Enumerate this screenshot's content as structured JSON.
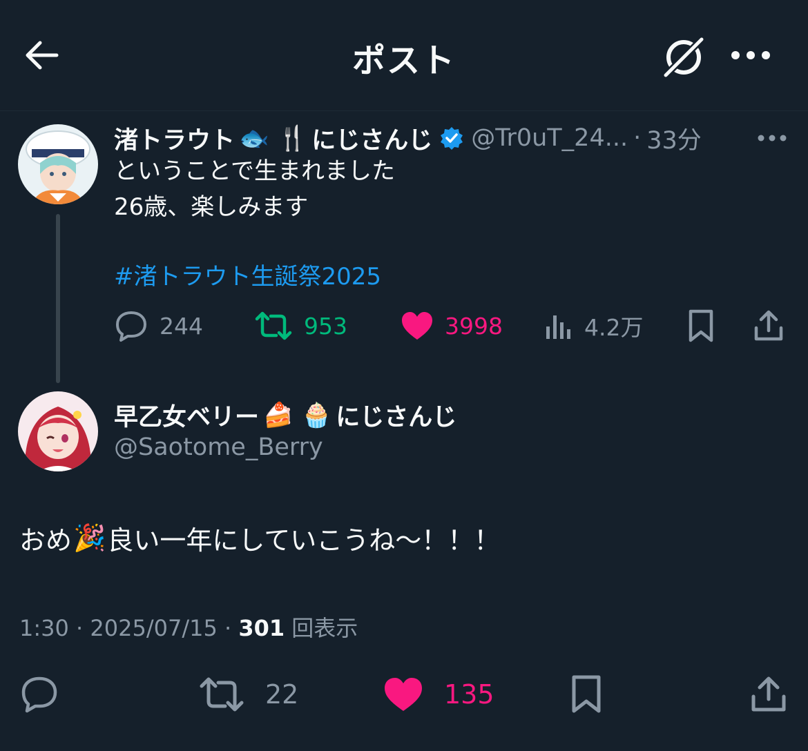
{
  "header": {
    "title": "ポスト"
  },
  "post": {
    "display_name": "渚トラウト",
    "name_emojis": [
      "🐟",
      "🍴"
    ],
    "affiliation": "にじさんじ",
    "handle": "@Tr0uT_24...",
    "separator": "·",
    "time": "33分",
    "lines": [
      "ということで生まれました",
      "26歳、楽しみます"
    ],
    "hashtag": "#渚トラウト生誕祭2025",
    "replies": "244",
    "reposts": "953",
    "likes": "3998",
    "views": "4.2万"
  },
  "reply": {
    "display_name": "早乙女ベリー",
    "name_emojis": [
      "🍰",
      "🧁"
    ],
    "affiliation": "にじさんじ",
    "handle": "@Saotome_Berry",
    "text_before": "おめ",
    "text_emoji": "🎉",
    "text_after": "良い一年にしていこうね〜！！！",
    "time": "1:30",
    "date": "2025/07/15",
    "separator": "·",
    "view_count": "301",
    "view_label": "回表示",
    "reposts": "22",
    "likes": "135"
  },
  "colors": {
    "background": "#15202b",
    "text": "#f7f9f9",
    "muted": "#8b98a5",
    "link": "#1d9bf0",
    "repost": "#00ba7c",
    "like": "#f91880",
    "verified": "#1d9bf0"
  }
}
